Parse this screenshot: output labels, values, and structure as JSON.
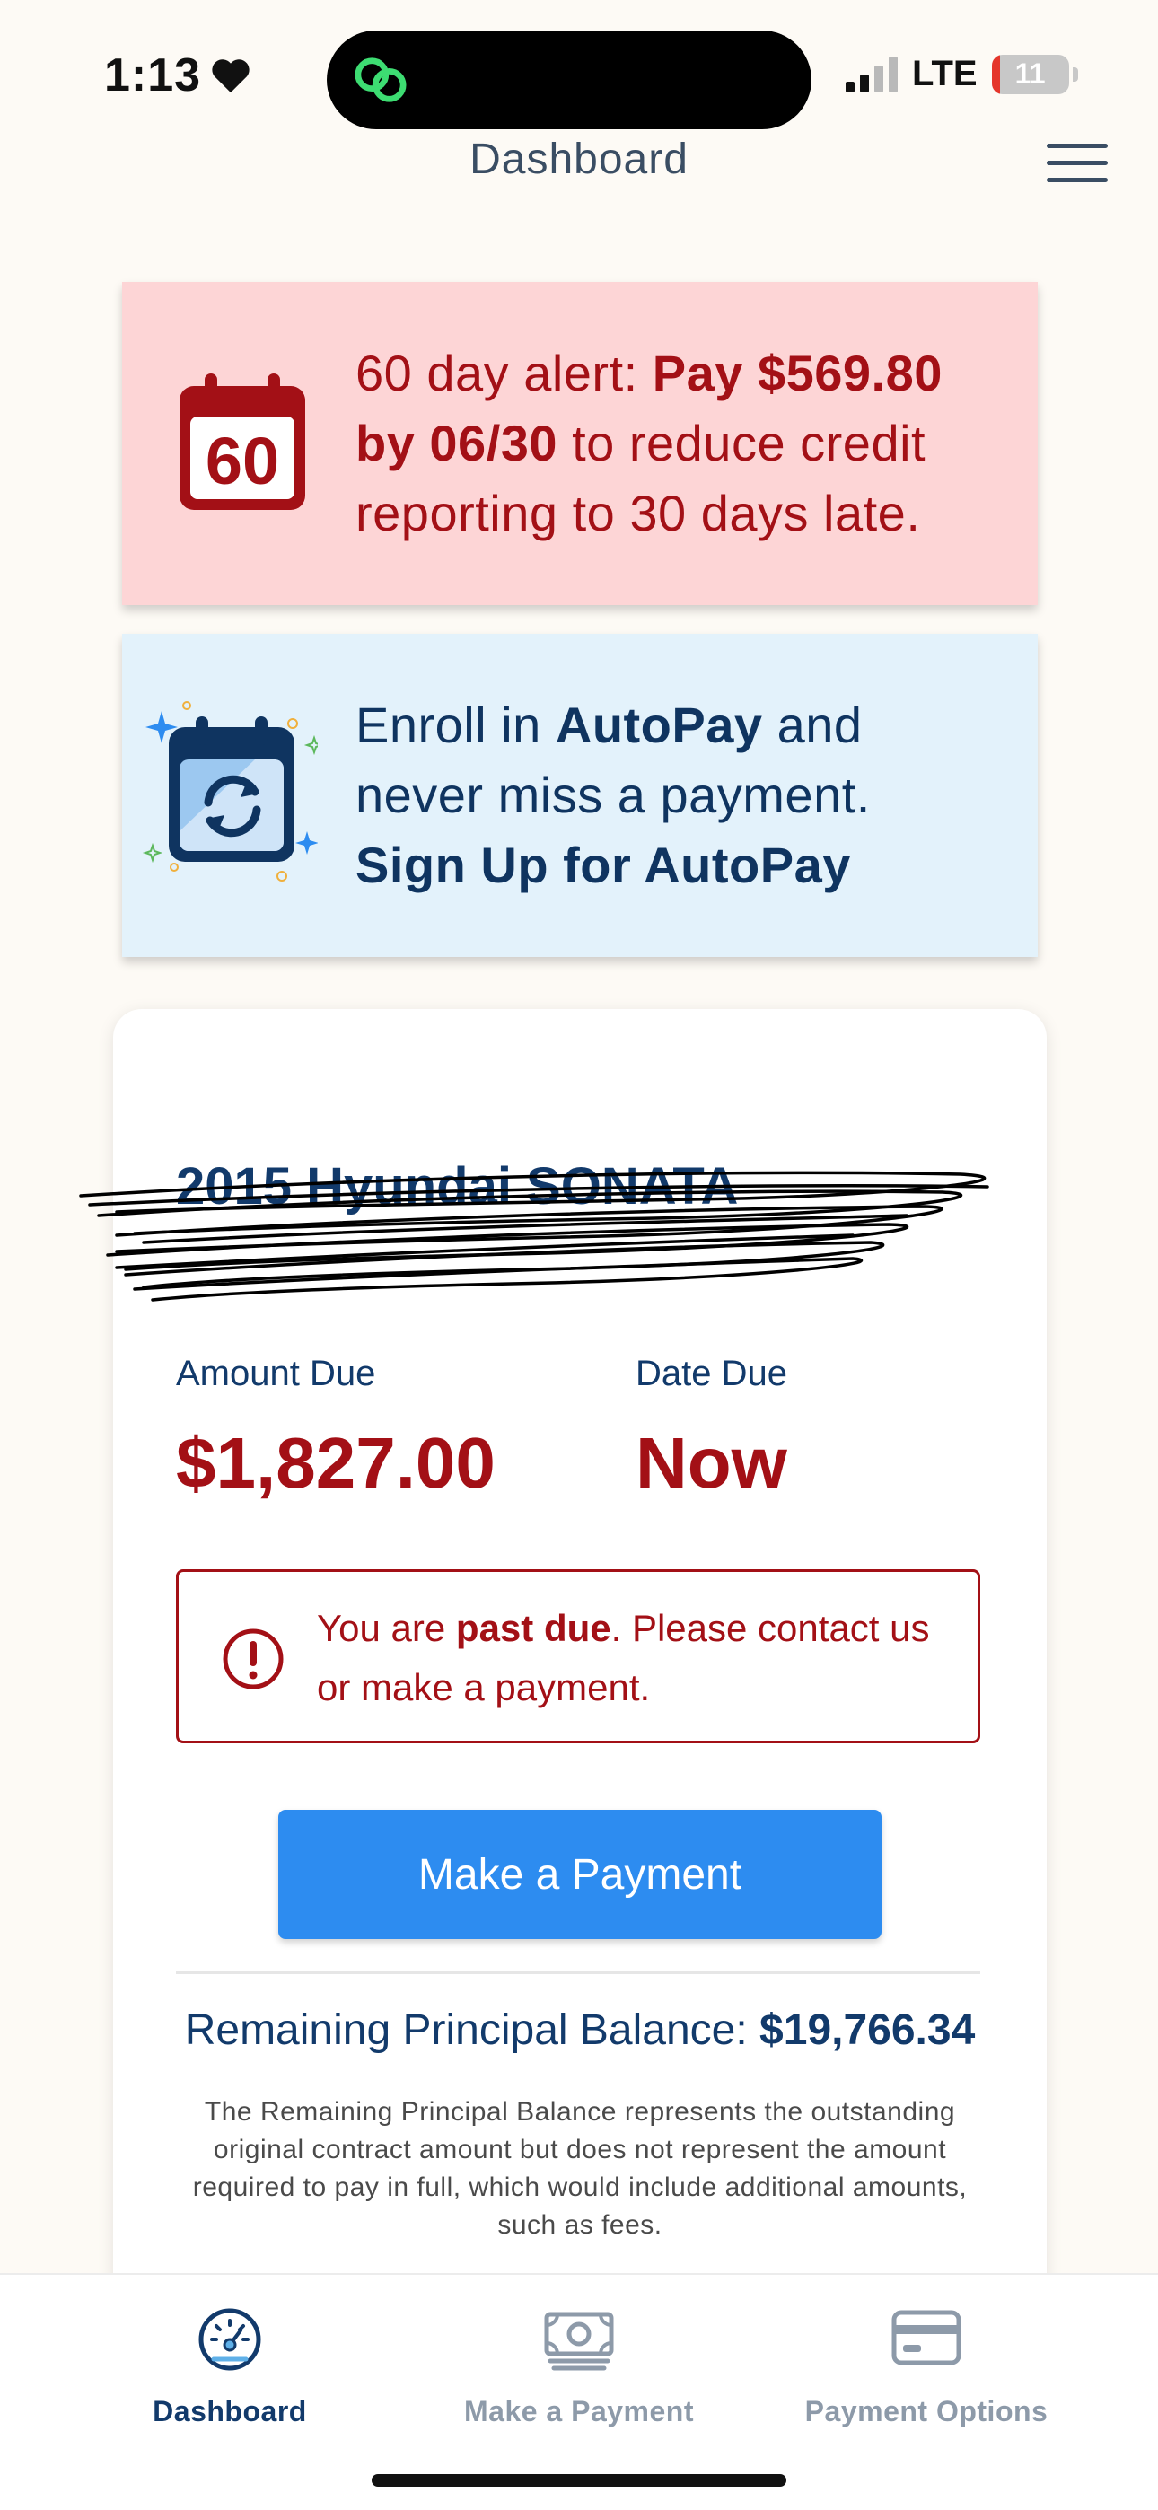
{
  "status_bar": {
    "time": "1:13",
    "network": "LTE",
    "battery": "11",
    "battery_level": 0.11
  },
  "header": {
    "title": "Dashboard"
  },
  "alert_banner": {
    "icon_number": "60",
    "text_prefix": "60 day alert: ",
    "text_bold": "Pay $569.80 by 06/30",
    "text_suffix": " to reduce credit reporting to 30 days late."
  },
  "autopay_banner": {
    "text_prefix": "Enroll in ",
    "text_bold": "AutoPay",
    "text_suffix": " and never miss a payment.",
    "link_text": "Sign Up for AutoPay"
  },
  "account": {
    "vehicle": "2015 Hyundai SONATA",
    "amount_due_label": "Amount Due",
    "amount_due_value": "$1,827.00",
    "date_due_label": "Date Due",
    "date_due_value": "Now",
    "past_due": {
      "text_prefix": "You are ",
      "text_bold": "past due",
      "text_suffix": ". Please contact us or make a payment."
    },
    "pay_button_label": "Make a Payment",
    "principal_label": "Remaining Principal Balance: ",
    "principal_value": "$19,766.34",
    "principal_note": "The Remaining Principal Balance represents the outstanding original contract amount but does not represent the amount required to pay in full, which would include additional amounts, such as fees."
  },
  "bottom_nav": {
    "items": [
      {
        "label": "Dashboard",
        "icon": "speedometer-icon",
        "active": true
      },
      {
        "label": "Make a Payment",
        "icon": "cash-icon",
        "active": false
      },
      {
        "label": "Payment Options",
        "icon": "card-icon",
        "active": false
      }
    ]
  },
  "colors": {
    "alert_red": "#a31016",
    "alert_bg": "#fdd5d6",
    "autopay_bg": "#e3f2fb",
    "navy": "#123a6b",
    "button_blue": "#2d8cf0"
  }
}
